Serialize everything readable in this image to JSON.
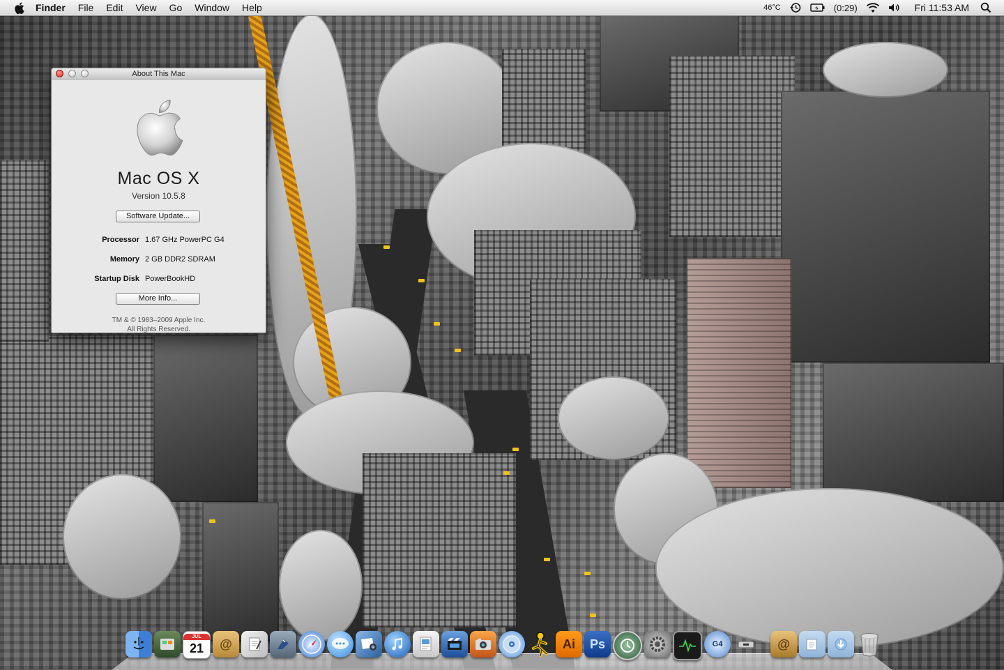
{
  "menubar": {
    "app_name": "Finder",
    "menus": [
      "File",
      "Edit",
      "View",
      "Go",
      "Window",
      "Help"
    ],
    "temperature": "46°C",
    "battery": "(0:29)",
    "clock": "Fri 11:53 AM"
  },
  "window": {
    "title": "About This Mac",
    "os_name": "Mac OS X",
    "version": "Version 10.5.8",
    "software_update_label": "Software Update...",
    "processor_label": "Processor",
    "processor_value": "1.67 GHz PowerPC G4",
    "memory_label": "Memory",
    "memory_value": "2 GB DDR2 SDRAM",
    "startup_disk_label": "Startup Disk",
    "startup_disk_value": "PowerBookHD",
    "more_info_label": "More Info...",
    "legal_line1": "TM & © 1983–2009 Apple Inc.",
    "legal_line2": "All Rights Reserved."
  },
  "dock": {
    "calendar_month": "JUL",
    "calendar_day": "21",
    "illustrator_label": "Ai",
    "photoshop_label": "Ps",
    "g4_label": "G4"
  },
  "colors": {
    "menubar_bg": "#e6e6e6",
    "window_bg": "#e8e8e8",
    "close_button": "#d42a1f",
    "taxi_yellow": "#f2c21a",
    "crane_orange": "#e6a21e"
  }
}
